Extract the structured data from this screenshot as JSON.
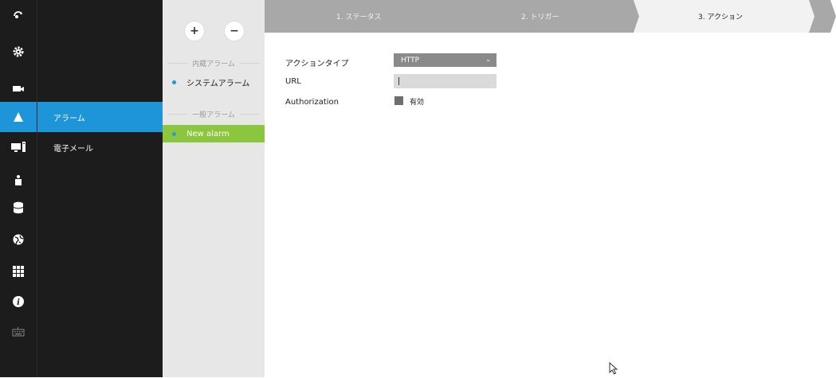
{
  "rail": {
    "icons": [
      "live-view-icon",
      "settings-gear-icon",
      "video-camera-icon",
      "alarm-icon",
      "monitor-device-icon",
      "user-icon",
      "database-icon",
      "network-globe-icon",
      "apps-grid-icon",
      "info-icon",
      "keyboard-icon"
    ],
    "active_index": 3
  },
  "submenu": {
    "items": [
      {
        "label": "アラーム",
        "active": true
      },
      {
        "label": "電子メール",
        "active": false
      }
    ]
  },
  "alarm_list": {
    "add_label": "+",
    "remove_label": "−",
    "builtin_section": "内蔵アラーム",
    "builtin_items": [
      {
        "label": "システムアラーム"
      }
    ],
    "general_section": "一般アラーム",
    "general_items": [
      {
        "label": "New alarm",
        "active": true
      }
    ]
  },
  "wizard": {
    "steps": [
      {
        "label": "1. ステータス",
        "state": "inactive"
      },
      {
        "label": "2. トリガー",
        "state": "inactive"
      },
      {
        "label": "3. アクション",
        "state": "active"
      }
    ]
  },
  "form": {
    "action_type_label": "アクションタイプ",
    "action_type_value": "HTTP",
    "url_label": "URL",
    "url_value": "",
    "auth_label": "Authorization",
    "auth_checkbox_label": "有効",
    "auth_enabled": true
  },
  "colors": {
    "accent": "#1d95d8",
    "active_alarm": "#8cc63f",
    "rail_bg": "#1c1c1c",
    "list_bg": "#e7e7e7",
    "step_inactive": "#a8a8a8",
    "step_active": "#f2f2f2"
  }
}
